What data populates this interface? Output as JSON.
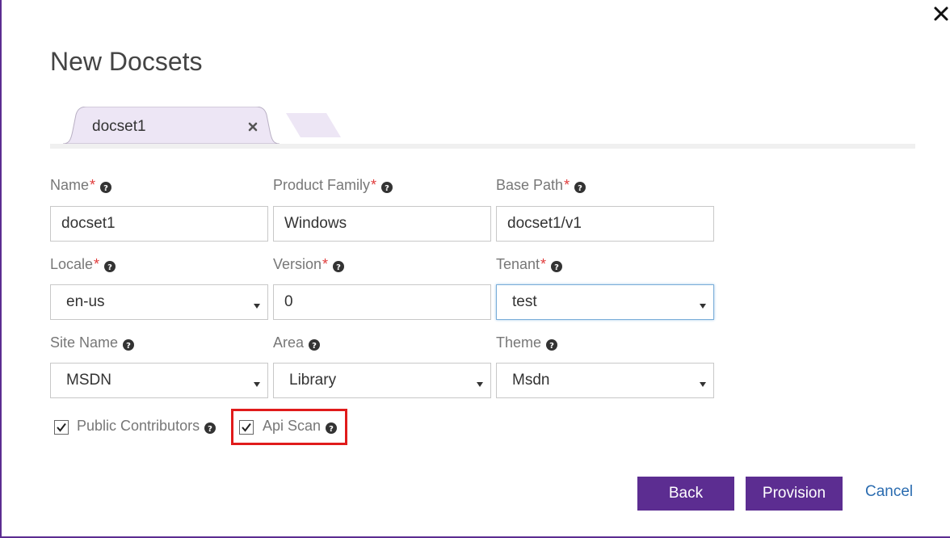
{
  "dialog": {
    "title": "New Docsets",
    "close_icon": "close-icon"
  },
  "tabs": [
    {
      "label": "docset1",
      "close_icon": "close-icon"
    }
  ],
  "form": {
    "name": {
      "label": "Name",
      "required": "*",
      "value": "docset1"
    },
    "product_family": {
      "label": "Product Family",
      "required": "*",
      "value": "Windows"
    },
    "base_path": {
      "label": "Base Path",
      "required": "*",
      "value": "docset1/v1"
    },
    "locale": {
      "label": "Locale",
      "required": "*",
      "value": "en-us"
    },
    "version": {
      "label": "Version",
      "required": "*",
      "value": "0"
    },
    "tenant": {
      "label": "Tenant",
      "required": "*",
      "value": "test"
    },
    "site_name": {
      "label": "Site Name",
      "value": "MSDN"
    },
    "area": {
      "label": "Area",
      "value": "Library"
    },
    "theme": {
      "label": "Theme",
      "value": "Msdn"
    },
    "public_contributors": {
      "label": "Public Contributors",
      "checked": true
    },
    "api_scan": {
      "label": "Api Scan",
      "checked": true
    }
  },
  "actions": {
    "back": "Back",
    "provision": "Provision",
    "cancel": "Cancel"
  },
  "colors": {
    "accent": "#5c2d91",
    "tab_bg": "#ede6f5",
    "required": "#e03c3c",
    "highlight": "#e01b1b",
    "link": "#2b6cb0"
  }
}
